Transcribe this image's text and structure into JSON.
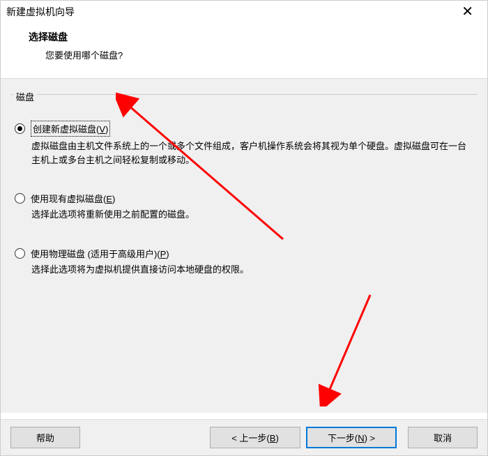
{
  "titlebar": {
    "title": "新建虚拟机向导"
  },
  "header": {
    "title": "选择磁盘",
    "subtitle": "您要使用哪个磁盘?"
  },
  "fieldset": {
    "label": "磁盘"
  },
  "options": {
    "create": {
      "label_prefix": "创建新虚拟磁盘(",
      "label_key": "V",
      "label_suffix": ")",
      "desc": "虚拟磁盘由主机文件系统上的一个或多个文件组成，客户机操作系统会将其视为单个硬盘。虚拟磁盘可在一台主机上或多台主机之间轻松复制或移动。"
    },
    "existing": {
      "label_prefix": "使用现有虚拟磁盘(",
      "label_key": "E",
      "label_suffix": ")",
      "desc": "选择此选项将重新使用之前配置的磁盘。"
    },
    "physical": {
      "label_prefix": "使用物理磁盘 (适用于高级用户)(",
      "label_key": "P",
      "label_suffix": ")",
      "desc": "选择此选项将为虚拟机提供直接访问本地硬盘的权限。"
    }
  },
  "buttons": {
    "help": "帮助",
    "back_prefix": "< 上一步(",
    "back_key": "B",
    "back_suffix": ")",
    "next_prefix": "下一步(",
    "next_key": "N",
    "next_suffix": ") >",
    "cancel": "取消"
  }
}
